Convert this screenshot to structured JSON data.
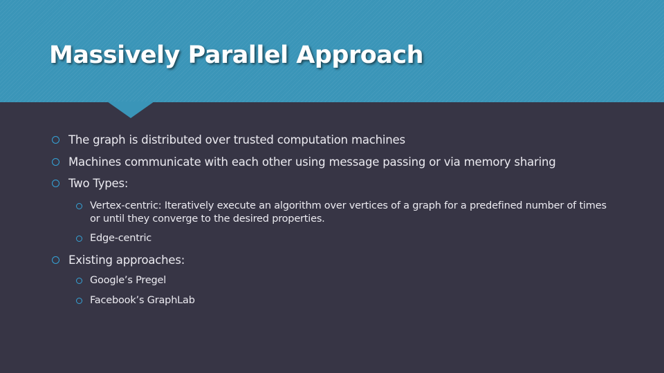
{
  "slide": {
    "title": "Massively Parallel Approach",
    "bullets": [
      {
        "level": 1,
        "text": "The graph is distributed over trusted computation machines"
      },
      {
        "level": 1,
        "text": "Machines communicate with each other using message passing or via memory sharing"
      },
      {
        "level": 1,
        "text": "Two Types:"
      },
      {
        "level": 2,
        "text": "Vertex-centric: Iteratively execute an algorithm over vertices of a graph for a predefined number of times or until they converge to the desired properties."
      },
      {
        "level": 2,
        "text": "Edge-centric"
      },
      {
        "level": 1,
        "text": "Existing approaches:"
      },
      {
        "level": 2,
        "text": "Google’s Pregel"
      },
      {
        "level": 2,
        "text": "Facebook’s GraphLab"
      }
    ]
  },
  "colors": {
    "header": "#3a95b8",
    "background": "#373545",
    "bullet_marker": "#35a4d8",
    "text": "#ecebf1",
    "title": "#ffffff"
  },
  "icons": {
    "bullet": "hollow-circle-icon"
  }
}
